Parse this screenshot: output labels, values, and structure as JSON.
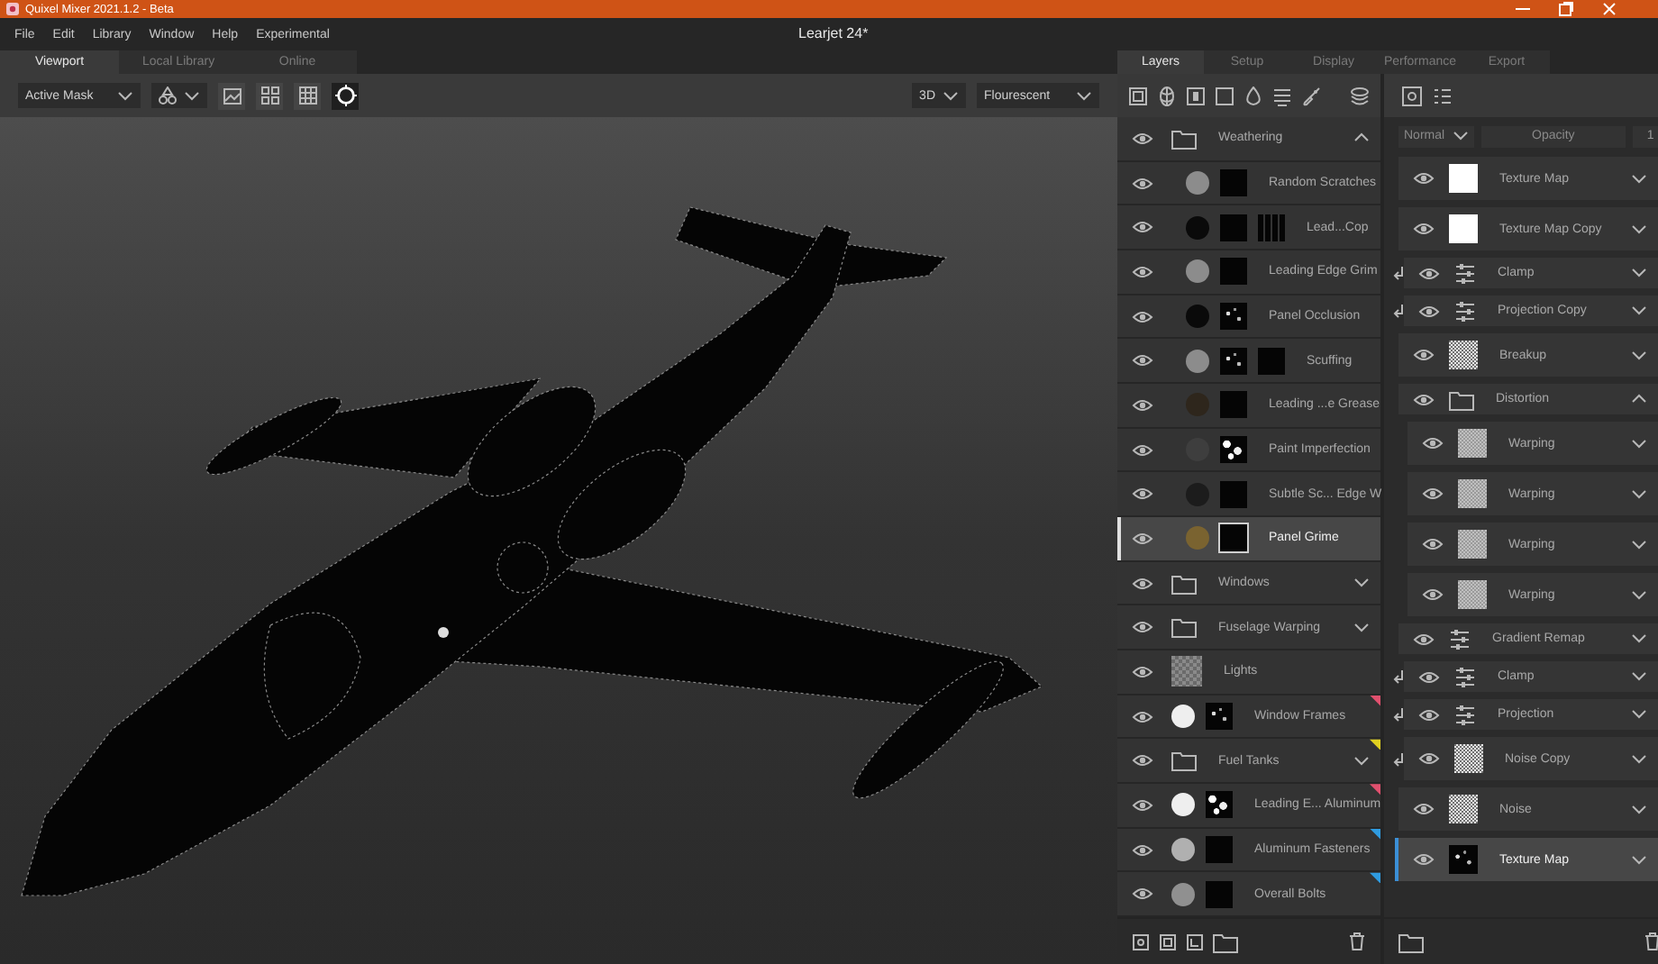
{
  "window": {
    "title": "Quixel Mixer 2021.1.2 - Beta"
  },
  "menu": [
    "File",
    "Edit",
    "Library",
    "Window",
    "Help",
    "Experimental"
  ],
  "document_title": "Learjet 24*",
  "viewport_tabs": [
    {
      "label": "Viewport",
      "selected": true
    },
    {
      "label": "Local Library",
      "selected": false
    },
    {
      "label": "Online",
      "selected": false
    }
  ],
  "viewport_toolbar": {
    "mask_dropdown": "Active Mask",
    "view_mode": "3D",
    "lighting": "Flourescent"
  },
  "panel_tabs": [
    {
      "label": "Layers",
      "selected": true
    },
    {
      "label": "Setup",
      "selected": false
    },
    {
      "label": "Display",
      "selected": false
    },
    {
      "label": "Performance",
      "selected": false
    },
    {
      "label": "Export",
      "selected": false
    }
  ],
  "layers": [
    {
      "kind": "folder",
      "name": "Weathering",
      "expanded": true,
      "selected": false,
      "children": [
        {
          "kind": "layer",
          "name": "Random Scratches",
          "color": "#8c8c8c",
          "thumbs": [
            {
              "kind": "dark"
            }
          ],
          "selected": false
        },
        {
          "kind": "layer",
          "name": "Lead...Cop",
          "color": "#0a0a0a",
          "thumbs": [
            {
              "kind": "dark"
            },
            {
              "kind": "grid"
            }
          ],
          "selected": false
        },
        {
          "kind": "layer",
          "name": "Leading Edge Grim",
          "color": "#8c8c8c",
          "thumbs": [
            {
              "kind": "dark"
            }
          ],
          "selected": false
        },
        {
          "kind": "layer",
          "name": "Panel Occlusion",
          "color": "#0a0a0a",
          "thumbs": [
            {
              "kind": "speckle"
            }
          ],
          "selected": false
        },
        {
          "kind": "layer",
          "name": "Scuffing",
          "color": "#8c8c8c",
          "thumbs": [
            {
              "kind": "speckle"
            },
            {
              "kind": "dark"
            }
          ],
          "selected": false
        },
        {
          "kind": "layer",
          "name": "Leading ...e Grease",
          "color": "#2e261c",
          "thumbs": [
            {
              "kind": "dark"
            }
          ],
          "selected": false
        },
        {
          "kind": "layer",
          "name": "Paint Imperfection",
          "color": "#3e3e3e",
          "thumbs": [
            {
              "kind": "bright"
            }
          ],
          "selected": false
        },
        {
          "kind": "layer",
          "name": "Subtle Sc... Edge W",
          "color": "#1c1c1c",
          "thumbs": [
            {
              "kind": "dark"
            }
          ],
          "selected": false
        },
        {
          "kind": "layer",
          "name": "Panel Grime",
          "color": "#7a6330",
          "thumbs": [
            {
              "kind": "dark"
            }
          ],
          "selected": true
        }
      ]
    },
    {
      "kind": "folder",
      "name": "Windows",
      "expanded": false,
      "selected": false
    },
    {
      "kind": "folder",
      "name": "Fuselage Warping",
      "expanded": false,
      "selected": false
    },
    {
      "kind": "layer",
      "name": "Lights",
      "thumbs": [
        {
          "kind": "checker"
        }
      ],
      "selected": false
    },
    {
      "kind": "layer",
      "name": "Window Frames",
      "color": "#eeeeee",
      "thumbs": [
        {
          "kind": "speckle"
        }
      ],
      "tag": {
        "color": "#e0506e"
      },
      "selected": false
    },
    {
      "kind": "folder",
      "name": "Fuel Tanks",
      "expanded": false,
      "tag": {
        "color": "#e0d020"
      },
      "selected": false
    },
    {
      "kind": "layer",
      "name": "Leading E... Aluminum",
      "color": "#eeeeee",
      "thumbs": [
        {
          "kind": "bright"
        }
      ],
      "tag": {
        "color": "#e0506e"
      },
      "selected": false
    },
    {
      "kind": "layer",
      "name": "Aluminum Fasteners",
      "color": "#b0b0b0",
      "thumbs": [
        {
          "kind": "dark"
        }
      ],
      "tag": {
        "color": "#2f9be0"
      },
      "selected": false
    },
    {
      "kind": "layer",
      "name": "Overall Bolts",
      "color": "#909090",
      "thumbs": [
        {
          "kind": "dark"
        }
      ],
      "tag": {
        "color": "#2f9be0"
      },
      "selected": false
    }
  ],
  "properties": {
    "blend_mode": "Normal",
    "opacity_label": "Opacity",
    "opacity_value": "1",
    "stack": [
      {
        "kind": "texture",
        "name": "Texture Map",
        "thumb": {
          "kind": "white"
        },
        "selected": false
      },
      {
        "kind": "texture",
        "name": "Texture Map Copy",
        "thumb": {
          "kind": "white"
        },
        "selected": false,
        "children": [
          {
            "kind": "adjust",
            "name": "Clamp",
            "selected": false
          },
          {
            "kind": "adjust",
            "name": "Projection Copy",
            "selected": false
          }
        ]
      },
      {
        "kind": "texture",
        "name": "Breakup",
        "thumb": {
          "kind": "noise"
        },
        "selected": false
      },
      {
        "kind": "folder",
        "name": "Distortion",
        "expanded": true,
        "selected": false,
        "children": [
          {
            "kind": "texture",
            "name": "Warping",
            "thumb": {
              "kind": "soft"
            },
            "selected": false
          },
          {
            "kind": "texture",
            "name": "Warping",
            "thumb": {
              "kind": "soft"
            },
            "selected": false
          },
          {
            "kind": "texture",
            "name": "Warping",
            "thumb": {
              "kind": "soft"
            },
            "selected": false
          },
          {
            "kind": "texture",
            "name": "Warping",
            "thumb": {
              "kind": "soft"
            },
            "selected": false
          }
        ]
      },
      {
        "kind": "adjust",
        "name": "Gradient Remap",
        "selected": false,
        "children": [
          {
            "kind": "adjust",
            "name": "Clamp",
            "selected": false
          },
          {
            "kind": "adjust",
            "name": "Projection",
            "selected": false
          },
          {
            "kind": "texture",
            "name": "Noise Copy",
            "thumb": {
              "kind": "noise"
            },
            "selected": false
          }
        ]
      },
      {
        "kind": "texture",
        "name": "Noise",
        "thumb": {
          "kind": "noise"
        },
        "selected": false
      },
      {
        "kind": "texture",
        "name": "Texture Map",
        "thumb": {
          "kind": "speckle"
        },
        "selected": true
      }
    ]
  }
}
